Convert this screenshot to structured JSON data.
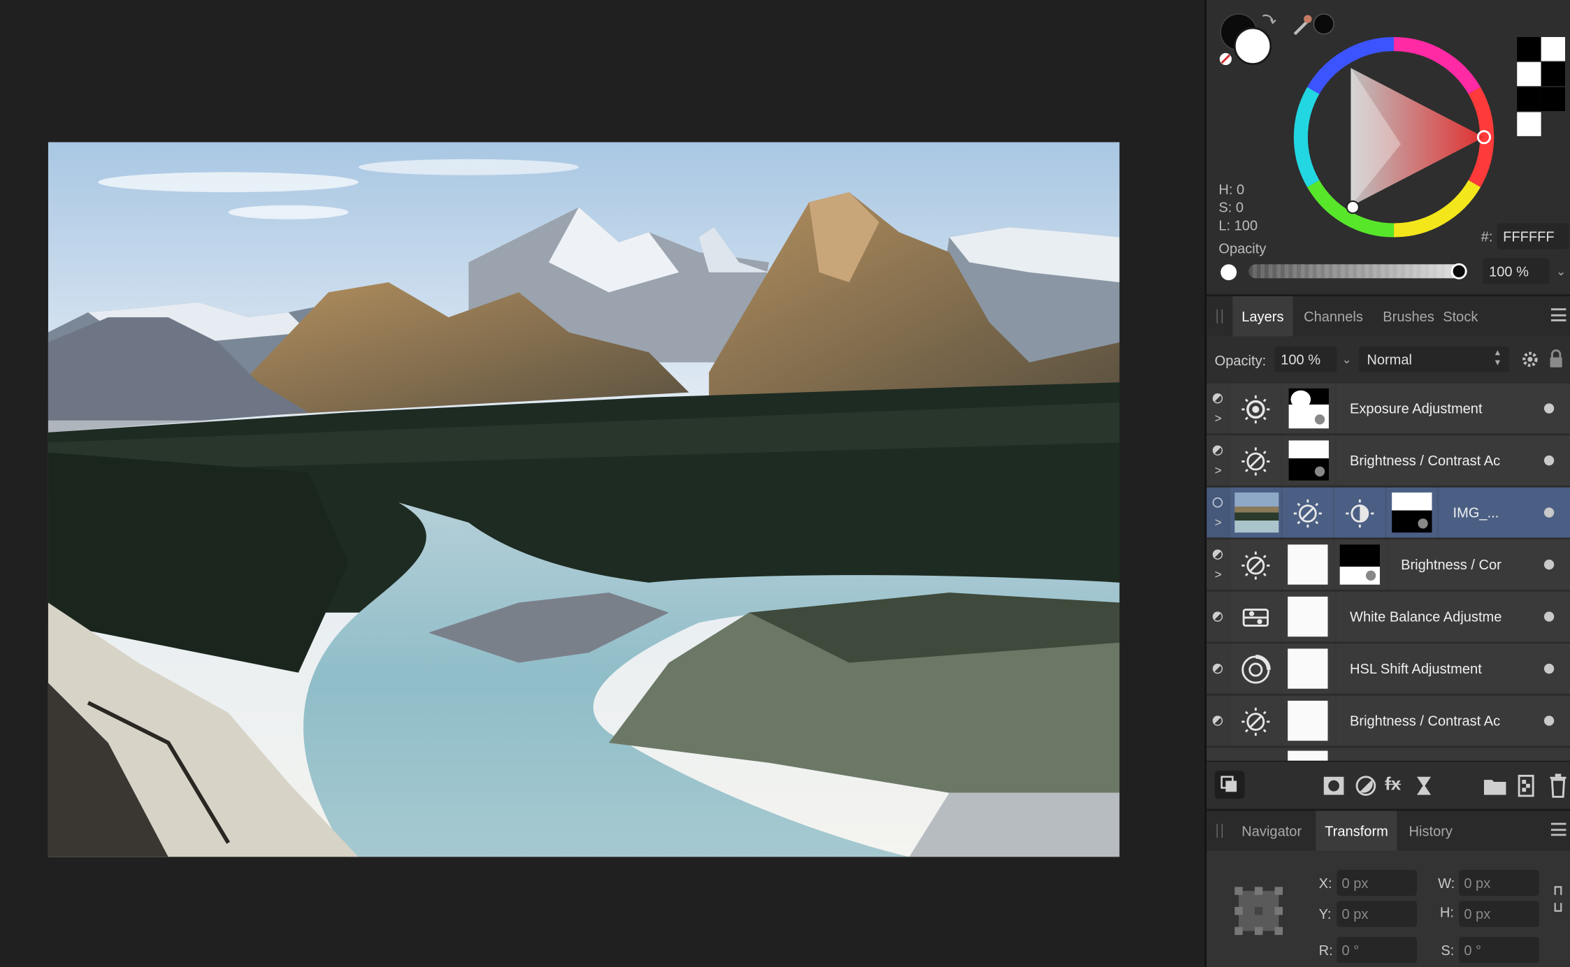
{
  "colors": {
    "background": "#202020",
    "panel": "#2e2e2e",
    "selected_row": "#46597a",
    "hue_marker": "#ff0000"
  },
  "color_panel": {
    "h_label": "H: 0",
    "s_label": "S: 0",
    "l_label": "L: 100",
    "hex_prefix": "#:",
    "hex_value": "FFFFFF",
    "opacity_label": "Opacity",
    "opacity_value": "100 %",
    "opacity_fraction": 1.0
  },
  "layers_panel": {
    "tabs": [
      {
        "label": "Layers",
        "active": true
      },
      {
        "label": "Channels",
        "active": false
      },
      {
        "label": "Brushes",
        "active": false
      },
      {
        "label": "Stock",
        "active": false
      }
    ],
    "opacity_label": "Opacity:",
    "opacity_value": "100 %",
    "blend_mode": "Normal",
    "layers": [
      {
        "name": "Exposure Adjustment",
        "icon": "exposure-icon",
        "selected": false
      },
      {
        "name": "Brightness / Contrast Ac",
        "icon": "brightness-contrast-icon",
        "selected": false
      },
      {
        "name": "IMG_...",
        "icon": "image-icon",
        "selected": true
      },
      {
        "name": "Brightness / Cor",
        "icon": "brightness-contrast-icon",
        "selected": false
      },
      {
        "name": "White Balance Adjustme",
        "icon": "white-balance-icon",
        "selected": false
      },
      {
        "name": "HSL Shift Adjustment",
        "icon": "hsl-icon",
        "selected": false
      },
      {
        "name": "Brightness / Contrast Ac",
        "icon": "brightness-contrast-icon",
        "selected": false
      }
    ]
  },
  "transform_panel": {
    "tabs": [
      {
        "label": "Navigator",
        "active": false
      },
      {
        "label": "Transform",
        "active": true
      },
      {
        "label": "History",
        "active": false
      }
    ],
    "x_label": "X:",
    "x_value": "0 px",
    "y_label": "Y:",
    "y_value": "0 px",
    "w_label": "W:",
    "w_value": "0 px",
    "h_label": "H:",
    "h_value": "0 px",
    "r_label": "R:",
    "r_value": "0 °",
    "s_label": "S:",
    "s_value": "0 °"
  }
}
